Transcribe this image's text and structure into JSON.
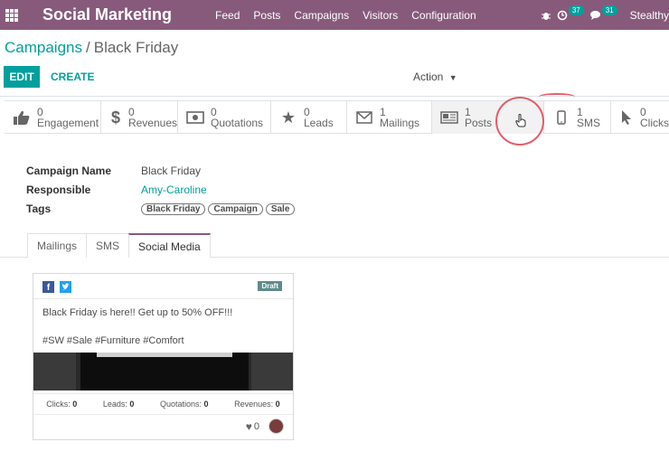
{
  "topbar": {
    "app_title": "Social Marketing",
    "menu": [
      "Feed",
      "Posts",
      "Campaigns",
      "Visitors",
      "Configuration"
    ],
    "activity_count": "37",
    "messages_count": "31",
    "user": "Stealthy"
  },
  "breadcrumb": {
    "parent": "Campaigns",
    "separator": "/",
    "current": "Black Friday"
  },
  "buttons": {
    "edit": "EDIT",
    "create": "CREATE",
    "action": "Action"
  },
  "stats": [
    {
      "value": "0",
      "label": "Engagement",
      "icon": "thumbs-up-icon"
    },
    {
      "value": "0",
      "label": "Revenues",
      "icon": "dollar-icon"
    },
    {
      "value": "0",
      "label": "Quotations",
      "icon": "money-icon"
    },
    {
      "value": "0",
      "label": "Leads",
      "icon": "star-icon"
    },
    {
      "value": "1",
      "label": "Mailings",
      "icon": "envelope-icon"
    },
    {
      "value": "1",
      "label": "Posts",
      "icon": "newspaper-icon"
    },
    {
      "value": "1",
      "label": "SMS",
      "icon": "mobile-icon"
    },
    {
      "value": "0",
      "label": "Clicks",
      "icon": "pointer-icon"
    }
  ],
  "fields": {
    "name_label": "Campaign Name",
    "name_value": "Black Friday",
    "responsible_label": "Responsible",
    "responsible_value": "Amy-Caroline",
    "tags_label": "Tags",
    "tags": [
      "Black Friday",
      "Campaign",
      "Sale"
    ]
  },
  "tabs": [
    "Mailings",
    "SMS",
    "Social Media"
  ],
  "post_card": {
    "status": "Draft",
    "message": "Black Friday is here!! Get up to 50% OFF!!!",
    "hashtags": "#SW #Sale #Furniture #Comfort",
    "clicks_label": "Clicks:",
    "clicks": "0",
    "leads_label": "Leads:",
    "leads": "0",
    "quotations_label": "Quotations:",
    "quotations": "0",
    "revenues_label": "Revenues:",
    "revenues": "0",
    "likes": "0"
  }
}
